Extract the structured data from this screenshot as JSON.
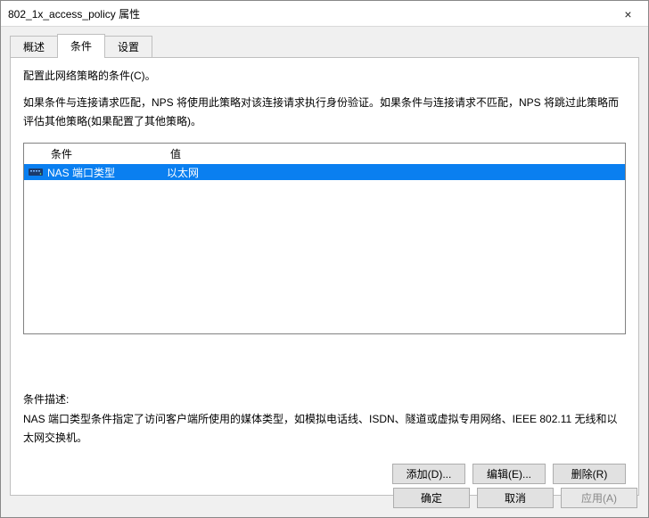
{
  "window": {
    "title": "802_1x_access_policy 属性",
    "close_label": "×"
  },
  "tabs": {
    "overview": "概述",
    "conditions": "条件",
    "settings": "设置"
  },
  "instructions": {
    "line1": "配置此网络策略的条件(C)。",
    "line2": "如果条件与连接请求匹配，NPS 将使用此策略对该连接请求执行身份验证。如果条件与连接请求不匹配，NPS 将跳过此策略而评估其他策略(如果配置了其他策略)。"
  },
  "list": {
    "headers": {
      "condition": "条件",
      "value": "值"
    },
    "rows": [
      {
        "condition": "NAS 端口类型",
        "value": "以太网",
        "icon": "nas-icon"
      }
    ]
  },
  "description": {
    "label": "条件描述:",
    "text": "NAS 端口类型条件指定了访问客户端所使用的媒体类型，如模拟电话线、ISDN、隧道或虚拟专用网络、IEEE 802.11 无线和以太网交换机。"
  },
  "buttons": {
    "add": "添加(D)...",
    "edit": "编辑(E)...",
    "remove": "删除(R)"
  },
  "dialog_buttons": {
    "ok": "确定",
    "cancel": "取消",
    "apply": "应用(A)"
  }
}
